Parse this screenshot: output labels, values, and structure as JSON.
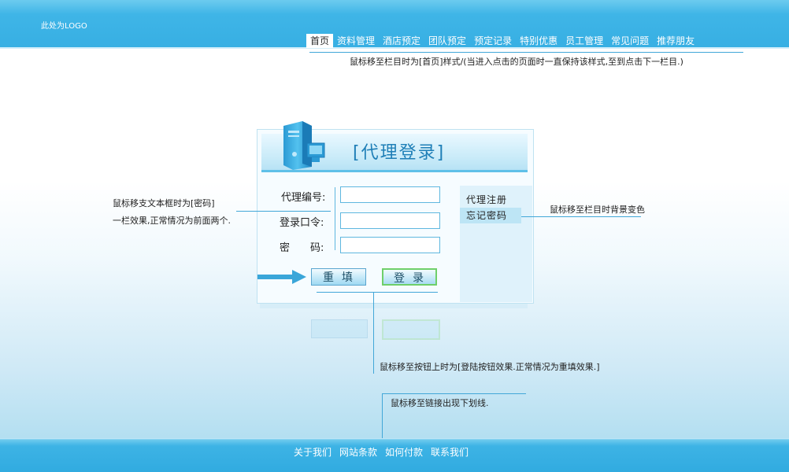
{
  "header": {
    "logo_text": "此处为LOGO",
    "nav": [
      {
        "label": "首页",
        "active": true
      },
      {
        "label": "资料管理"
      },
      {
        "label": "酒店预定"
      },
      {
        "label": "团队预定"
      },
      {
        "label": "预定记录"
      },
      {
        "label": "特别优惠"
      },
      {
        "label": "员工管理"
      },
      {
        "label": "常见问题"
      },
      {
        "label": "推荐朋友"
      }
    ]
  },
  "annotations": {
    "nav_note": "鼠标移至栏目时为[首页]样式/(当进入点击的页面时一直保持该样式,至到点击下一栏目.)",
    "textbox_note_line1": "鼠标移支文本框时为[密码]",
    "textbox_note_line2": "一栏效果,正常情况为前面两个.",
    "side_note": "鼠标移至栏目时背景变色",
    "button_note": "鼠标移至按钮上时为[登陆按钮效果.正常情况为重填效果.]",
    "link_note": "鼠标移至链接出现下划线."
  },
  "login": {
    "title": "[代理登录]",
    "fields": [
      {
        "label": "代理编号:",
        "value": ""
      },
      {
        "label": "登录口令:",
        "value": ""
      },
      {
        "label": "密　　码:",
        "value": ""
      }
    ],
    "reset_label": "重填",
    "login_label": "登录",
    "side_links": [
      "代理注册",
      "忘记密码"
    ]
  },
  "footer": {
    "links": [
      "关于我们",
      "网站条款",
      "如何付款",
      "联系我们"
    ]
  },
  "colors": {
    "brand_blue": "#3fb5e7",
    "title_blue": "#1f7fb7",
    "line_blue": "#42a7d8"
  }
}
